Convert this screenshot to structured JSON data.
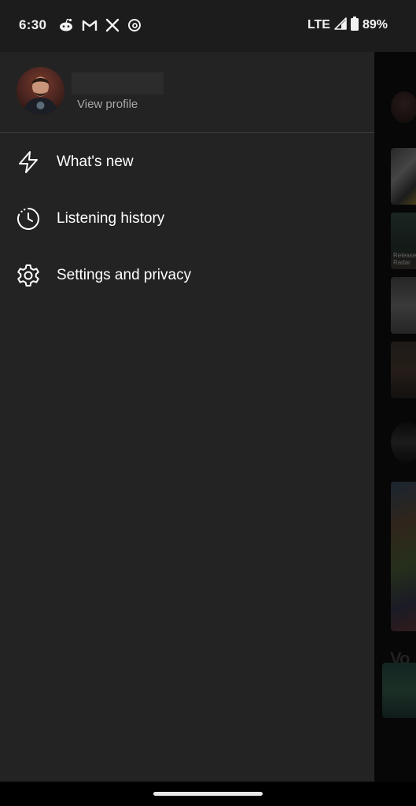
{
  "status_bar": {
    "time": "6:30",
    "notification_icons": [
      "reddit-icon",
      "gmail-icon",
      "x-icon",
      "threads-icon"
    ],
    "network": "LTE",
    "battery": "89%"
  },
  "drawer": {
    "profile": {
      "view_profile_label": "View profile"
    },
    "menu": [
      {
        "label": "What's new",
        "icon": "lightning-icon"
      },
      {
        "label": "Listening history",
        "icon": "history-icon"
      },
      {
        "label": "Settings and privacy",
        "icon": "gear-icon"
      }
    ]
  },
  "background": {
    "partial_text": "Vo",
    "tile_caption": "Release Radar"
  },
  "colors": {
    "drawer_bg": "#232323",
    "status_bar_bg": "#1c1c1c",
    "divider": "#3a3a3a",
    "muted_text": "#a7a7a7"
  }
}
